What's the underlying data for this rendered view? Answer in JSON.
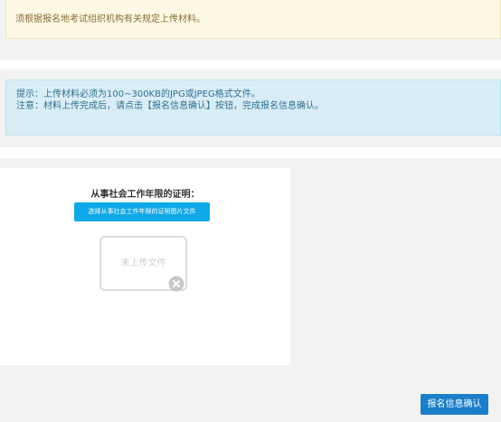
{
  "notice": {
    "text": "须根据报名地考试组织机构有关规定上传材料。"
  },
  "tips": {
    "line1": "提示：上传材料必须为100~300KB的JPG或JPEG格式文件。",
    "line2": "注意：材料上传完成后，请点击【报名信息确认】按钮，完成报名信息确认。"
  },
  "upload": {
    "title": "从事社会工作年限的证明：",
    "choose_button": "选择从事社会工作年限的证明图片文件",
    "preview_placeholder": "未上传文件",
    "remove_icon": "close-circle-icon"
  },
  "footer": {
    "confirm_button": "报名信息确认"
  },
  "colors": {
    "warning_bg": "#fcf8e3",
    "info_bg": "#d9edf7",
    "primary_button": "#0fa8e8",
    "confirm_button": "#1a7ec8"
  }
}
